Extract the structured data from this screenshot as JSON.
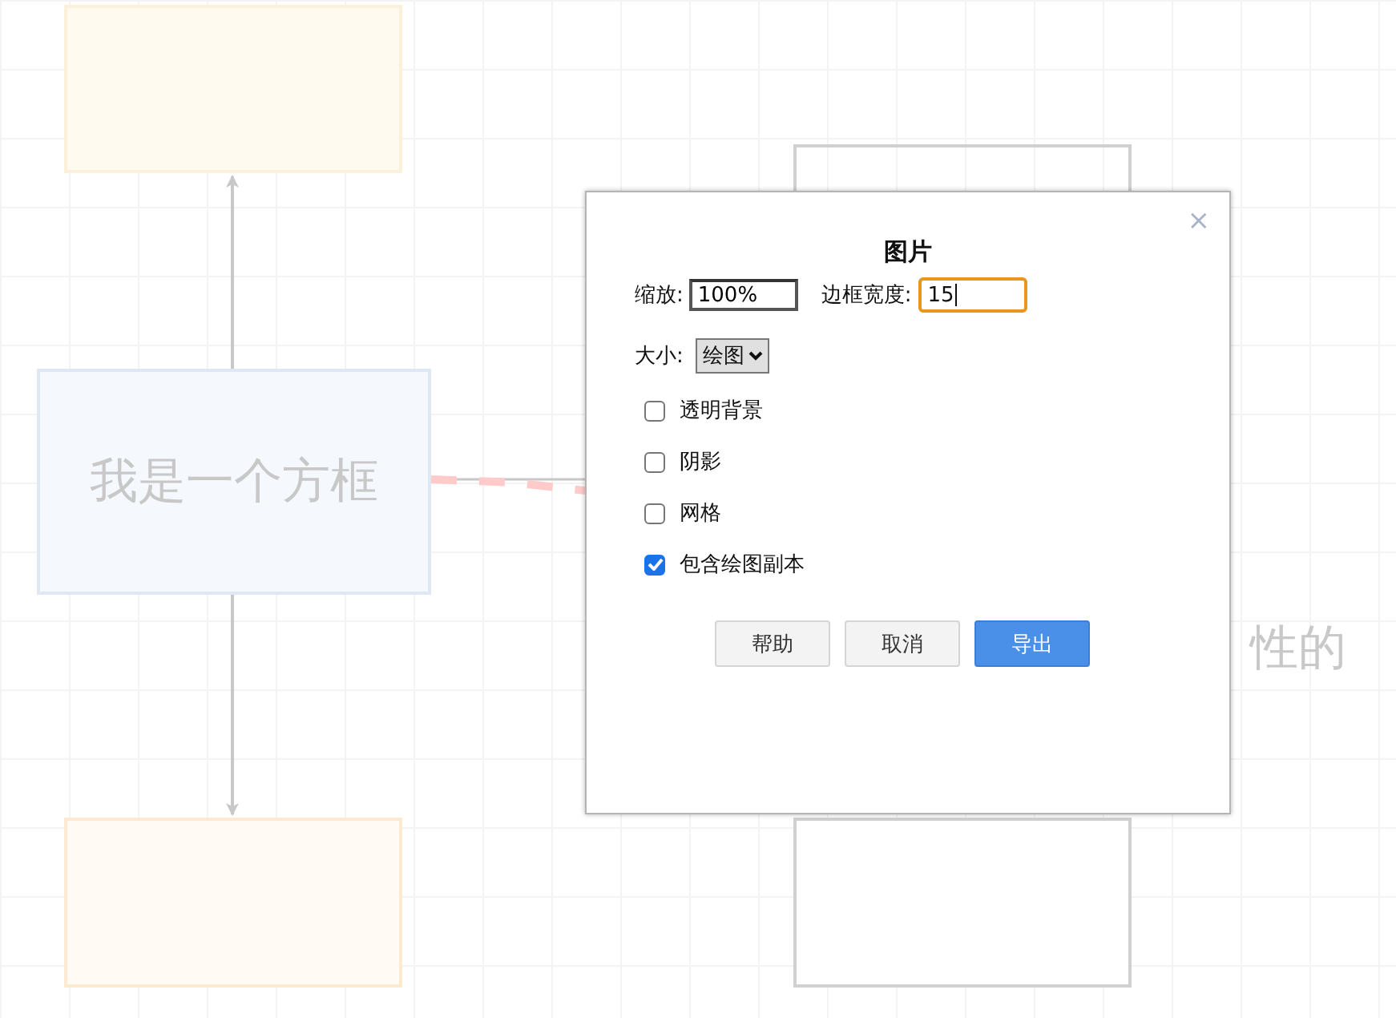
{
  "canvas": {
    "main_shape": {
      "label": "我是一个方框"
    },
    "partial_label": "性的"
  },
  "dialog": {
    "title": "图片",
    "close": "×",
    "zoom": {
      "label": "缩放:",
      "value": "100%"
    },
    "border_width": {
      "label": "边框宽度:",
      "value": "15",
      "focused": true
    },
    "size": {
      "label": "大小:",
      "value": "绘图"
    },
    "options": [
      {
        "label": "透明背景",
        "checked": false
      },
      {
        "label": "阴影",
        "checked": false
      },
      {
        "label": "网格",
        "checked": false
      },
      {
        "label": "包含绘图副本",
        "checked": true
      }
    ],
    "buttons": [
      {
        "label": "帮助",
        "kind": "secondary"
      },
      {
        "label": "取消",
        "kind": "secondary"
      },
      {
        "label": "导出",
        "kind": "primary"
      }
    ]
  }
}
